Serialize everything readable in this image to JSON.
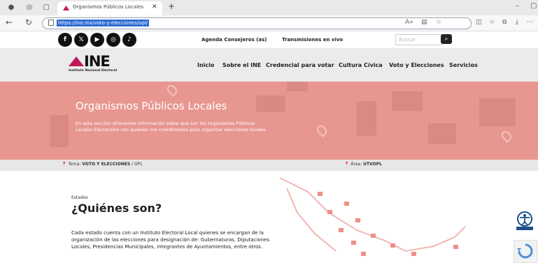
{
  "browser": {
    "tab_title": "Organismos Públicos Locales - In",
    "url": "https://ine.mx/voto-y-elecciones/opl/"
  },
  "topbar": {
    "link1": "Agenda Consejeros (as)",
    "link2": "Transmisiones en vivo",
    "search_placeholder": "Buscar",
    "social": [
      "facebook-icon",
      "x-icon",
      "youtube-icon",
      "instagram-icon",
      "tiktok-icon"
    ]
  },
  "logo": {
    "text": "INE",
    "sub": "Instituto Nacional Electoral"
  },
  "nav": [
    "Inicio",
    "Sobre el INE",
    "Credencial para votar",
    "Cultura Cívica",
    "Voto y Elecciones",
    "Servicios"
  ],
  "hero": {
    "title": "Organismos Públicos Locales",
    "desc": "En esta sección ofrecemos información sobre qué son los Organismos Públicos Locales Electorales con quienes nos coordinamos para organizar elecciones locales."
  },
  "crumbs": {
    "tema_label": "Tema:",
    "tema_value": "VOTO Y ELECCIONES",
    "tema_sub": "/ OPL",
    "area_label": "Área:",
    "area_value": "UTVOPL"
  },
  "content": {
    "kicker": "Estados",
    "heading": "¿Quiénes son?",
    "paragraph": "Cada estado cuenta con un Instituto Electoral Local quienes se encargan de la organización de las elecciones para designación de: Gubernaturas, Diputaciones Locales, Presidencias Municipales, integrantes de Ayuntamientos, entre otros."
  },
  "colors": {
    "brand": "#c2185b",
    "hero_bg": "#e89690"
  }
}
